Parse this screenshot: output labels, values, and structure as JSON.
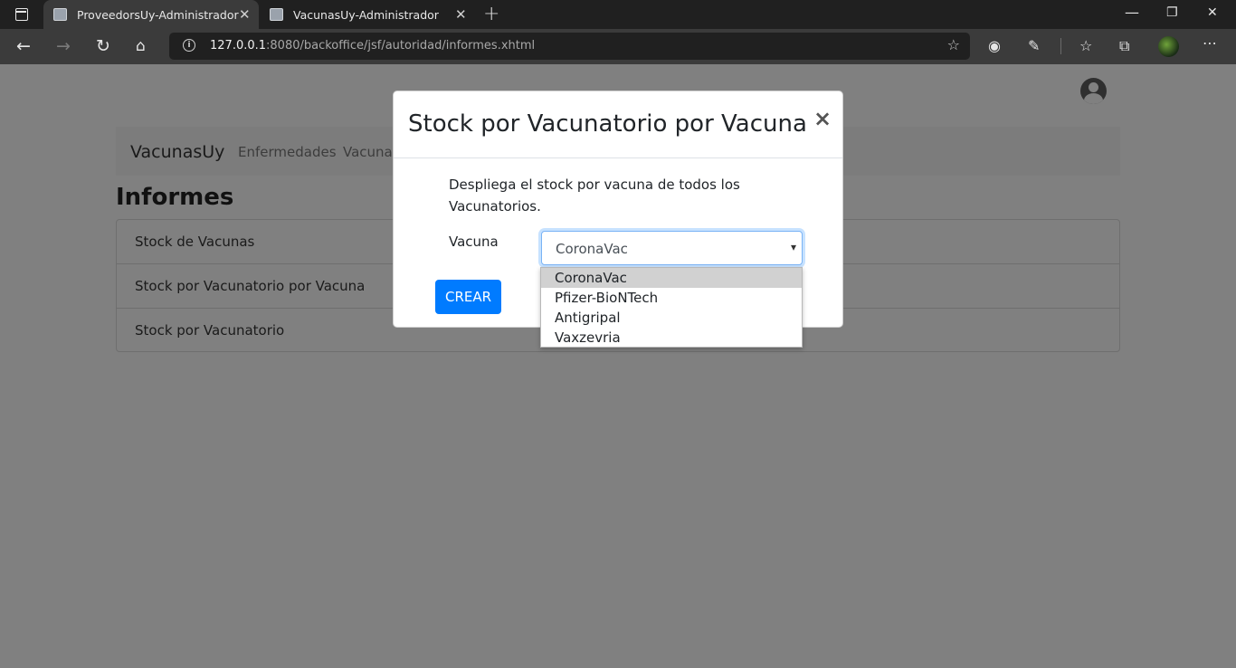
{
  "browser": {
    "tabs": [
      {
        "title": "ProveedorsUy-Administrador",
        "active": true
      },
      {
        "title": "VacunasUy-Administrador",
        "active": false
      }
    ],
    "url": {
      "host": "127.0.0.1",
      "rest": ":8080/backoffice/jsf/autoridad/informes.xhtml"
    },
    "icons": {
      "back": "back-arrow-icon",
      "forward": "forward-arrow-icon",
      "reload": "reload-icon",
      "home": "home-icon"
    }
  },
  "navbar": {
    "brand": "VacunasUy",
    "links": [
      "Enfermedades",
      "Vacunas"
    ]
  },
  "page": {
    "title": "Informes",
    "reports": [
      "Stock de Vacunas",
      "Stock por Vacunatorio por Vacuna",
      "Stock por Vacunatorio"
    ]
  },
  "modal": {
    "title": "Stock por Vacunatorio por Vacuna",
    "close": "×",
    "description": "Despliega el stock por vacuna de todos los Vacunatorios.",
    "field_label": "Vacuna",
    "selected_value": "CoronaVac",
    "options": [
      "CoronaVac",
      "Pfizer-BioNTech",
      "Antigripal",
      "Vaxzevria"
    ],
    "submit_label": "CREAR",
    "accent_color": "#007bff"
  }
}
